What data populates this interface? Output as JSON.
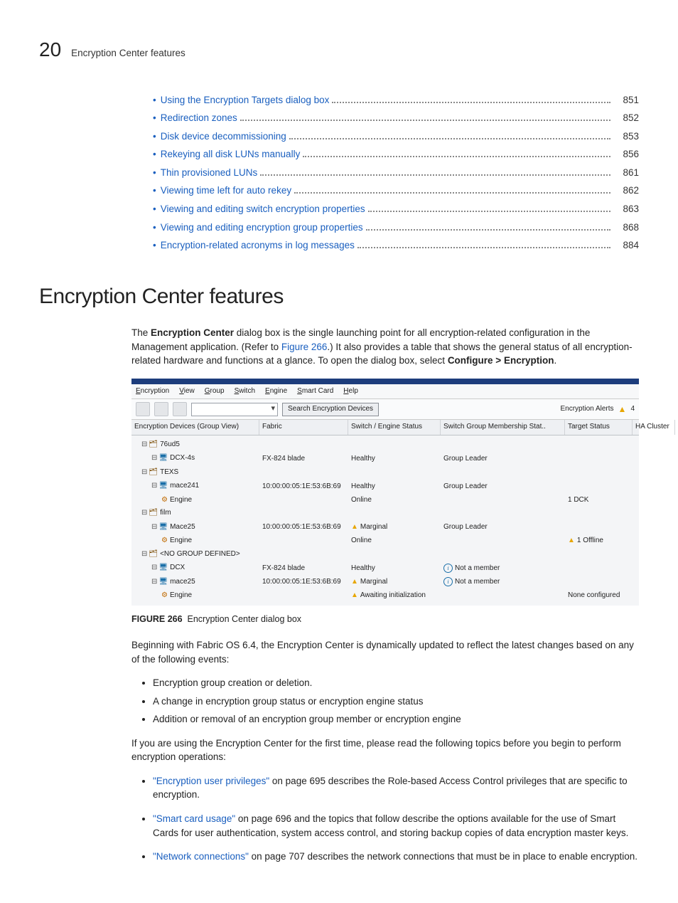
{
  "header": {
    "page_number": "20",
    "running_title": "Encryption Center features"
  },
  "toc": [
    {
      "label": "Using the Encryption Targets dialog box",
      "page": "851"
    },
    {
      "label": "Redirection zones",
      "page": "852"
    },
    {
      "label": "Disk device decommissioning",
      "page": "853"
    },
    {
      "label": "Rekeying all disk LUNs manually",
      "page": "856"
    },
    {
      "label": "Thin provisioned LUNs",
      "page": "861"
    },
    {
      "label": "Viewing time left for auto rekey",
      "page": "862"
    },
    {
      "label": "Viewing and editing switch encryption properties",
      "page": "863"
    },
    {
      "label": "Viewing and editing encryption group properties",
      "page": "868"
    },
    {
      "label": "Encryption-related acronyms in log messages",
      "page": "884"
    }
  ],
  "section_heading": "Encryption Center features",
  "intro": {
    "lead1": "The ",
    "bold1": "Encryption Center",
    "lead2": " dialog box is the single launching point for all encryption-related configuration in the Management application. (Refer to ",
    "fig_link": "Figure 266",
    "lead3": ".) It also provides a table that shows the general status of all encryption-related hardware and functions at a glance. To open the dialog box, select ",
    "bold2": "Configure > Encryption",
    "lead4": "."
  },
  "dialog": {
    "menus": [
      "Encryption",
      "View",
      "Group",
      "Switch",
      "Engine",
      "Smart Card",
      "Help"
    ],
    "search_button": "Search Encryption Devices",
    "alerts_label": "Encryption Alerts",
    "alerts_count": "4",
    "columns": [
      "Encryption Devices (Group View)",
      "Fabric",
      "Switch / Engine Status",
      "Switch Group Membership Stat..",
      "Target Status",
      "HA Cluster"
    ],
    "rows": [
      {
        "c0": "76ud5",
        "kind": "group",
        "indent": 1
      },
      {
        "c0": "DCX-4s",
        "kind": "switch",
        "indent": 2,
        "c1": "FX-824 blade",
        "c2": "Healthy",
        "c3": "Group Leader"
      },
      {
        "c0": "TEXS",
        "kind": "group",
        "indent": 1
      },
      {
        "c0": "mace241",
        "kind": "switch",
        "indent": 2,
        "c1": "10:00:00:05:1E:53:6B:69",
        "c2": "Healthy",
        "c3": "Group Leader"
      },
      {
        "c0": "Engine",
        "kind": "ee",
        "indent": 3,
        "c2": "Online",
        "c4": "1 DCK"
      },
      {
        "c0": "film",
        "kind": "group",
        "indent": 1
      },
      {
        "c0": "Mace25",
        "kind": "switch",
        "indent": 2,
        "c1": "10:00:00:05:1E:53:6B:69",
        "c2": "Marginal",
        "c2warn": true,
        "c3": "Group Leader"
      },
      {
        "c0": "Engine",
        "kind": "ee",
        "indent": 3,
        "c2": "Online",
        "c4": "1 Offline",
        "c4warn": true
      },
      {
        "c0": "<NO GROUP DEFINED>",
        "kind": "group",
        "indent": 1
      },
      {
        "c0": "DCX",
        "kind": "switch",
        "indent": 2,
        "c1": "FX-824 blade",
        "c2": "Healthy",
        "c3": "Not a member",
        "c3info": true
      },
      {
        "c0": "mace25",
        "kind": "switch",
        "indent": 2,
        "c1": "10:00:00:05:1E:53:6B:69",
        "c2": "Marginal",
        "c2warn": true,
        "c3": "Not a member",
        "c3info": true
      },
      {
        "c0": "Engine",
        "kind": "ee",
        "indent": 3,
        "c2": "Awaiting initialization",
        "c2warn": true,
        "c4": "None configured"
      }
    ]
  },
  "figure": {
    "label": "FIGURE 266",
    "caption": "Encryption Center dialog box"
  },
  "para2": "Beginning with Fabric OS 6.4, the Encryption Center is dynamically updated to reflect the latest changes based on any of the following events:",
  "events": [
    "Encryption group creation or deletion.",
    "A change in encryption group status or encryption engine status",
    "Addition or removal of an encryption group member or encryption engine"
  ],
  "para3": "If you are using the Encryption Center for the first time, please read the following topics before you begin to perform encryption operations:",
  "refs": [
    {
      "link": "\"Encryption user privileges\"",
      "tail": " on page 695 describes the Role-based Access Control privileges that are specific to encryption."
    },
    {
      "link": "\"Smart card usage\"",
      "tail": " on page 696 and the topics that follow describe the options available for the use of Smart Cards for user authentication, system access control, and storing backup copies of data encryption master keys."
    },
    {
      "link": "\"Network connections\"",
      "tail": " on page 707 describes the network connections that must be in place to enable encryption."
    }
  ]
}
